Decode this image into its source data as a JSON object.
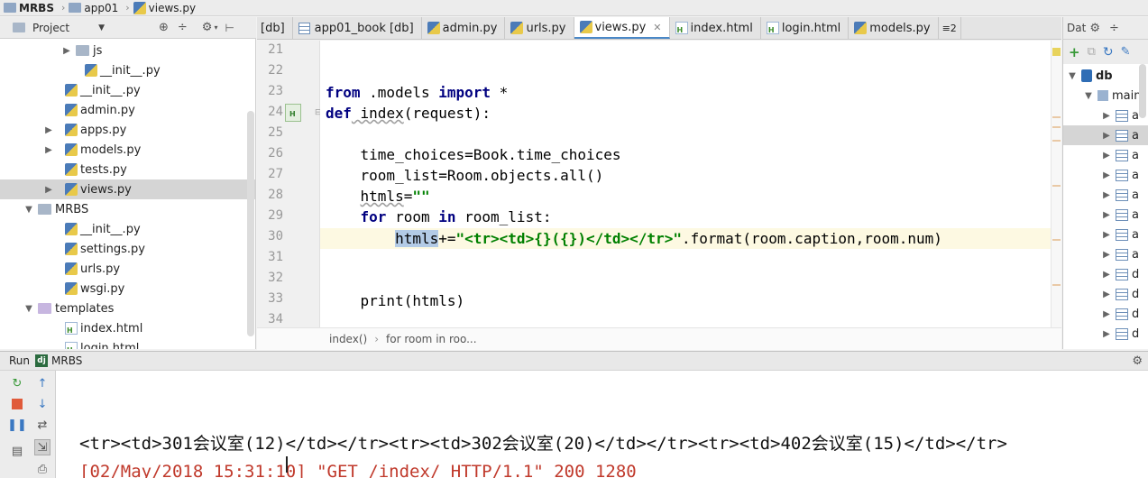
{
  "breadcrumb": {
    "project": "MRBS",
    "folder": "app01",
    "file": "views.py"
  },
  "project_panel": {
    "title": "Project",
    "items": [
      {
        "label": "js",
        "type": "dir",
        "expanded": false
      },
      {
        "label": "__init__.py",
        "type": "py"
      },
      {
        "label": "__init__.py",
        "type": "py"
      },
      {
        "label": "admin.py",
        "type": "py"
      },
      {
        "label": "apps.py",
        "type": "py"
      },
      {
        "label": "models.py",
        "type": "py"
      },
      {
        "label": "tests.py",
        "type": "py"
      },
      {
        "label": "views.py",
        "type": "py",
        "selected": true
      },
      {
        "label": "MRBS",
        "type": "dir",
        "expanded": true
      },
      {
        "label": "__init__.py",
        "type": "py"
      },
      {
        "label": "settings.py",
        "type": "py"
      },
      {
        "label": "urls.py",
        "type": "py"
      },
      {
        "label": "wsgi.py",
        "type": "py"
      },
      {
        "label": "templates",
        "type": "dir",
        "expanded": true
      },
      {
        "label": "index.html",
        "type": "html"
      },
      {
        "label": "login.html",
        "type": "html"
      }
    ]
  },
  "tabs": [
    {
      "label": "[db]"
    },
    {
      "label": "app01_book [db]"
    },
    {
      "label": "admin.py"
    },
    {
      "label": "urls.py"
    },
    {
      "label": "views.py",
      "active": true
    },
    {
      "label": "index.html"
    },
    {
      "label": "login.html"
    },
    {
      "label": "models.py"
    },
    {
      "label": "≡2"
    }
  ],
  "editor": {
    "line_numbers": [
      "21",
      "22",
      "23",
      "24",
      "25",
      "26",
      "27",
      "28",
      "29",
      "30",
      "31",
      "32",
      "33",
      "34"
    ],
    "code": {
      "l23_kw1": "from",
      "l23_mid": " .models ",
      "l23_kw2": "import",
      "l23_end": " *",
      "l24_kw": "def",
      "l24_name": " index",
      "l24_rest": "(request):",
      "l26": "    time_choices=Book.time_choices",
      "l27": "    room_list=Room.objects.all()",
      "l28_a": "    ",
      "l28_var": "htmls",
      "l28_b": "=",
      "l28_str": "\"\"",
      "l29_ind": "    ",
      "l29_kw1": "for",
      "l29_mid": " room ",
      "l29_kw2": "in",
      "l29_end": " room_list:",
      "l30_ind": "        ",
      "l30_var": "htmls",
      "l30_op": "+=",
      "l30_str": "\"<tr><td>{}({})</td></tr>\"",
      "l30_end": ".format(room.caption,room.num)",
      "l33_ind": "    ",
      "l33_fn": "print",
      "l33_rest": "(htmls)"
    },
    "breadcrumb": {
      "func": "index()",
      "loop": "for room in roo..."
    }
  },
  "db_panel": {
    "title": "Dat",
    "root": "db",
    "schema": "main",
    "tables": [
      "a",
      "a",
      "a",
      "a",
      "a",
      "a",
      "a",
      "a",
      "d",
      "d",
      "d",
      "d"
    ]
  },
  "run": {
    "label": "Run",
    "config": "MRBS",
    "output": [
      "<tr><td>301会议室(12)</td></tr><tr><td>302会议室(20)</td></tr><tr><td>402会议室(15)</td></tr>",
      "[02/May/2018 15:31:10] \"GET /index/ HTTP/1.1\" 200 1280"
    ]
  },
  "colors": {
    "keyword": "#000080",
    "string": "#008000",
    "selection": "#b3cbe6",
    "tab_accent": "#4a88c7"
  }
}
